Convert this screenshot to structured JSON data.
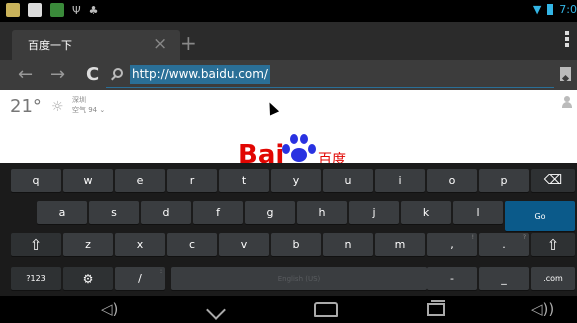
{
  "statusbar": {
    "time": "7:0",
    "icons": [
      "gallery-icon",
      "sd-card-icon",
      "android-icon",
      "usb-icon",
      "cat-icon"
    ]
  },
  "tab": {
    "title": "百度一下",
    "close_glyph": "×",
    "new_tab_glyph": "+"
  },
  "omnibox": {
    "url": "http://www.baidu.com/",
    "back_glyph": "←",
    "forward_glyph": "→",
    "reload_glyph": "C"
  },
  "page": {
    "temperature": "21°",
    "city": "深圳",
    "air_quality": "空气 94",
    "logo_left": "Bai",
    "logo_right": "百度"
  },
  "keyboard": {
    "row1": [
      "q",
      "w",
      "e",
      "r",
      "t",
      "y",
      "u",
      "i",
      "o",
      "p"
    ],
    "row2": [
      "a",
      "s",
      "d",
      "f",
      "g",
      "h",
      "j",
      "k",
      "l"
    ],
    "row3": [
      "z",
      "x",
      "c",
      "v",
      "b",
      "n",
      "m"
    ],
    "row3_hints": {
      "comma": "!",
      "period": "?"
    },
    "comma": ",",
    "period": ".",
    "go": "Go",
    "symbols": "?123",
    "settings_glyph": "⚙",
    "slash": "/",
    "slash_hint": ":",
    "space": "English (US)",
    "dash": "-",
    "underscore": "_",
    "dotcom": ".com",
    "shift_glyph": "⇧",
    "delete_glyph": "⌫"
  },
  "colors": {
    "accent": "#33b5e5",
    "url_highlight": "#2a6f97",
    "go_key": "#0b5a8a",
    "baidu_red": "#e10602",
    "baidu_blue": "#2932e1"
  }
}
